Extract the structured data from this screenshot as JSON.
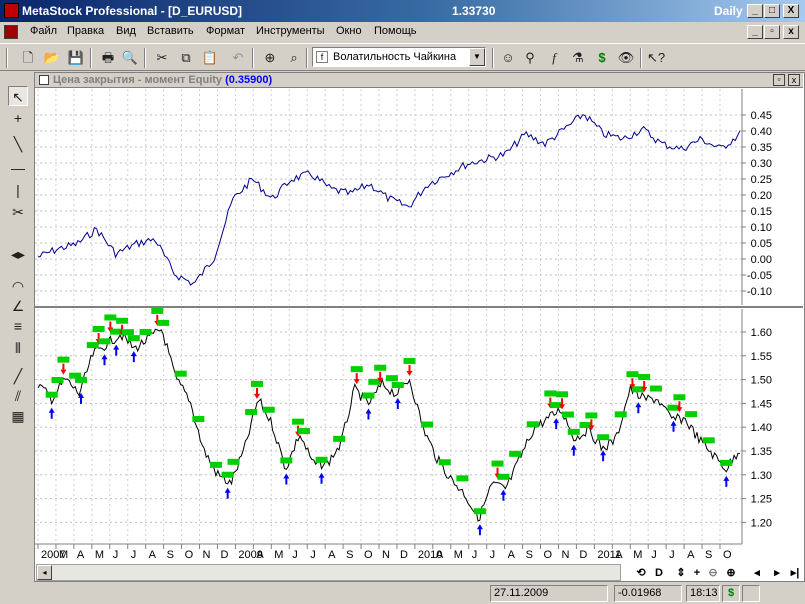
{
  "titlebar": {
    "title": "MetaStock Professional - [D_EURUSD]",
    "price": "1.33730",
    "period": "Daily",
    "min_label": "_",
    "max_label": "□",
    "close_label": "X"
  },
  "menubar": {
    "items": [
      "Файл",
      "Правка",
      "Вид",
      "Вставить",
      "Формат",
      "Инструменты",
      "Окно",
      "Помощь"
    ]
  },
  "toolbar": {
    "indicator_selected": "Волатильность Чайкина"
  },
  "pane_upper": {
    "title": "Цена закрытия - момент Equity",
    "value": "(0.35900)",
    "y_ticks": [
      "0.45",
      "0.40",
      "0.35",
      "0.30",
      "0.25",
      "0.20",
      "0.15",
      "0.10",
      "0.05",
      "0.00",
      "-0.05",
      "-0.10"
    ],
    "line_color": "#00008b"
  },
  "pane_lower": {
    "y_ticks": [
      "1.60",
      "1.55",
      "1.50",
      "1.45",
      "1.40",
      "1.35",
      "1.30",
      "1.25",
      "1.20"
    ],
    "buy_color": "#0000ff",
    "sell_color": "#ff0000",
    "label_color": "#00d000"
  },
  "x_axis": {
    "labels": [
      "2007",
      "M",
      "A",
      "M",
      "J",
      "J",
      "A",
      "S",
      "O",
      "N",
      "D",
      "2009",
      "A",
      "M",
      "J",
      "J",
      "A",
      "S",
      "O",
      "N",
      "D",
      "2010",
      "A",
      "M",
      "J",
      "J",
      "A",
      "S",
      "O",
      "N",
      "D",
      "2011",
      "A",
      "M",
      "J",
      "J",
      "A",
      "S",
      "O"
    ]
  },
  "statusbar": {
    "date": "27.11.2009",
    "value": "-0.01968",
    "time": "18:13"
  },
  "nav": {
    "d_label": "D"
  }
}
